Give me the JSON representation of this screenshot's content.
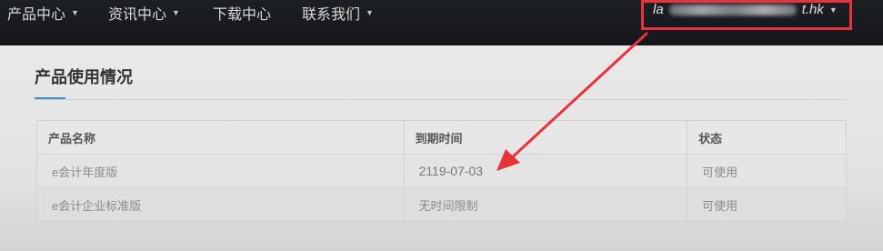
{
  "nav": {
    "items": [
      {
        "label": "产品中心",
        "has_dropdown": true
      },
      {
        "label": "资讯中心",
        "has_dropdown": true
      },
      {
        "label": "下载中心",
        "has_dropdown": false
      },
      {
        "label": "联系我们",
        "has_dropdown": true
      }
    ],
    "account": {
      "prefix": "la",
      "suffix": "t.hk",
      "caret": "▼"
    }
  },
  "section": {
    "title": "产品使用情况"
  },
  "table": {
    "headers": [
      "产品名称",
      "到期时间",
      "状态"
    ],
    "rows": [
      {
        "name": "e会计年度版",
        "expiry": "2119-07-03",
        "status": "可使用"
      },
      {
        "name": "e会计企业标准版",
        "expiry": "无时间限制",
        "status": "可使用"
      }
    ]
  },
  "annotation_color": "#e8333d"
}
